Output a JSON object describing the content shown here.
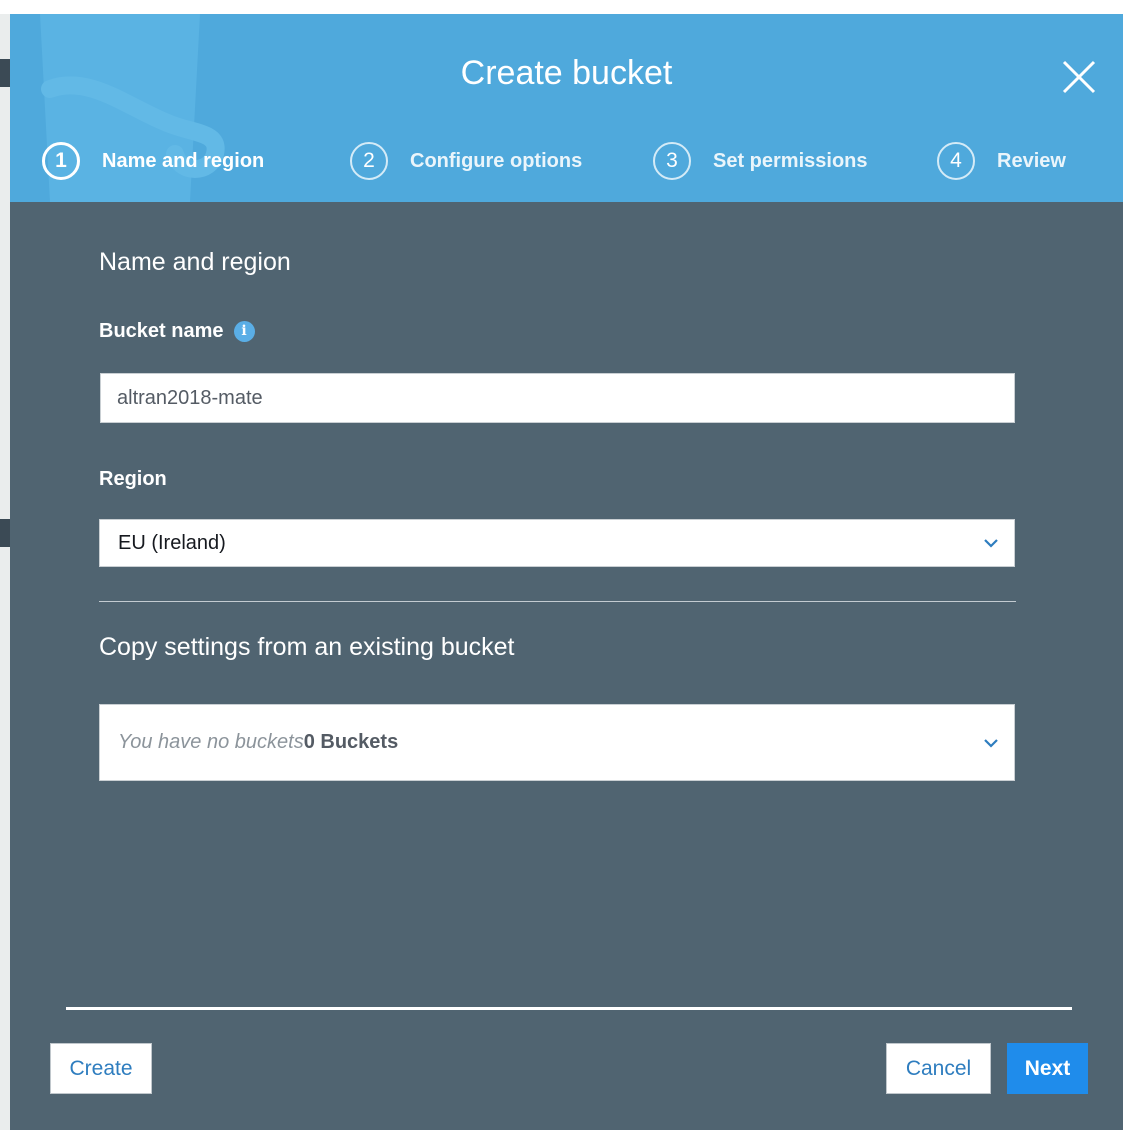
{
  "modal": {
    "title": "Create bucket",
    "colors": {
      "header_bg": "#4fa9dc",
      "body_bg": "#506471",
      "primary_button": "#1f8ceb",
      "link_text": "#2e7dbf"
    }
  },
  "steps": [
    {
      "number": "1",
      "label": "Name and region",
      "active": true
    },
    {
      "number": "2",
      "label": "Configure options",
      "active": false
    },
    {
      "number": "3",
      "label": "Set permissions",
      "active": false
    },
    {
      "number": "4",
      "label": "Review",
      "active": false
    }
  ],
  "form": {
    "section_title": "Name and region",
    "bucket_name": {
      "label": "Bucket name",
      "info_icon": "info-icon",
      "value": "altran2018-mate"
    },
    "region": {
      "label": "Region",
      "selected": "EU (Ireland)"
    },
    "copy_settings": {
      "title": "Copy settings from an existing bucket",
      "placeholder": "You have no buckets",
      "count_label": "0 Buckets"
    }
  },
  "footer": {
    "create_label": "Create",
    "cancel_label": "Cancel",
    "next_label": "Next"
  }
}
